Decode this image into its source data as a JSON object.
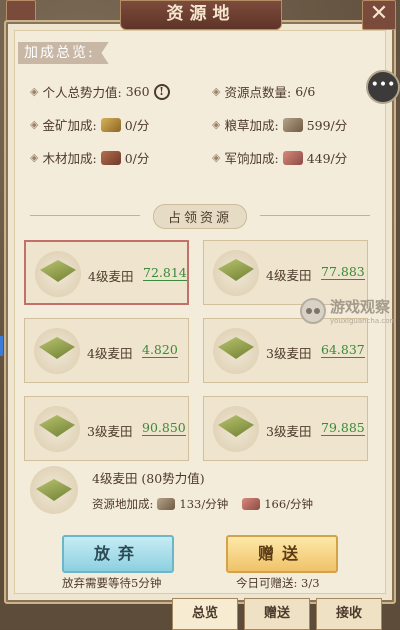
{
  "window": {
    "title": "资源地",
    "close_symbol": "✕"
  },
  "summary": {
    "section_title": "加成总览:",
    "stats": [
      {
        "label": "个人总势力值:",
        "value": "360",
        "icon": "info-icon"
      },
      {
        "label": "资源点数量:",
        "value": "6/6"
      },
      {
        "label": "金矿加成:",
        "value": "0/分",
        "icon": "gold-icon"
      },
      {
        "label": "粮草加成:",
        "value": "599/分",
        "icon": "grain-icon"
      },
      {
        "label": "木材加成:",
        "value": "0/分",
        "icon": "wood-icon"
      },
      {
        "label": "军饷加成:",
        "value": "449/分",
        "icon": "pay-icon"
      }
    ]
  },
  "occupied": {
    "section_title": "占领资源",
    "cards": [
      {
        "name": "4级麦田",
        "value": "72.814",
        "selected": true
      },
      {
        "name": "4级麦田",
        "value": "77.883"
      },
      {
        "name": "4级麦田",
        "value": "4.820"
      },
      {
        "name": "3级麦田",
        "value": "64.837"
      },
      {
        "name": "3级麦田",
        "value": "90.850"
      },
      {
        "name": "3级麦田",
        "value": "79.885"
      }
    ]
  },
  "detail": {
    "title": "4级麦田 (80势力值)",
    "bonus_label": "资源地加成:",
    "bonus_grain": "133/分钟",
    "bonus_pay": "166/分钟"
  },
  "actions": {
    "abandon_label": "放弃",
    "abandon_note": "放弃需要等待5分钟",
    "gift_label": "赠送",
    "gift_note": "今日可赠送: 3/3"
  },
  "tabs": [
    {
      "label": "总览",
      "active": true
    },
    {
      "label": "赠送"
    },
    {
      "label": "接收"
    }
  ],
  "watermark": {
    "cn": "游戏观察",
    "en": "youxiguancha.com"
  },
  "colors": {
    "accent_green": "#3a8a3a",
    "title_bar": "#6e3e30",
    "panel": "#f4ecdb"
  }
}
